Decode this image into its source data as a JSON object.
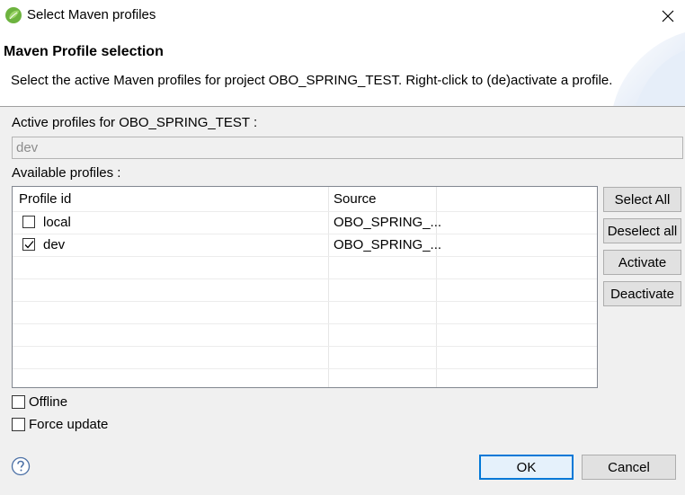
{
  "window": {
    "title": "Select Maven profiles",
    "app_icon": "eclipse-spring-leaf-icon",
    "close_icon": "close-icon"
  },
  "header": {
    "title": "Maven Profile selection",
    "description": "Select the active Maven profiles for project OBO_SPRING_TEST. Right-click to (de)activate a profile."
  },
  "active_profiles": {
    "label": "Active profiles for OBO_SPRING_TEST :",
    "value": "dev"
  },
  "available_profiles": {
    "label": "Available profiles :",
    "columns": [
      "Profile id",
      "Source"
    ],
    "rows": [
      {
        "checked": false,
        "id": "local",
        "source": "OBO_SPRING_..."
      },
      {
        "checked": true,
        "id": "dev",
        "source": "OBO_SPRING_..."
      }
    ]
  },
  "side_buttons": {
    "select_all": "Select All",
    "deselect_all": "Deselect all",
    "activate": "Activate",
    "deactivate": "Deactivate"
  },
  "options": {
    "offline": {
      "label": "Offline",
      "checked": false
    },
    "force_update": {
      "label": "Force update",
      "checked": false
    }
  },
  "footer": {
    "help_icon": "help-question-icon",
    "ok": "OK",
    "cancel": "Cancel"
  },
  "colors": {
    "dialog_bg": "#f0f0f0",
    "accent": "#0078d7",
    "leaf_green": "#6db33f"
  }
}
